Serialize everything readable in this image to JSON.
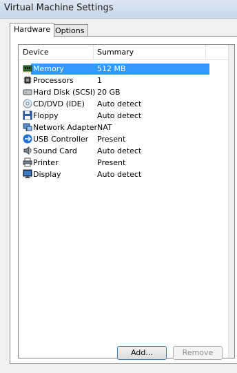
{
  "window": {
    "title": "Virtual Machine Settings"
  },
  "tabs": [
    {
      "label": "Hardware",
      "selected": true
    },
    {
      "label": "Options",
      "selected": false
    }
  ],
  "list": {
    "headers": {
      "device": "Device",
      "summary": "Summary"
    },
    "rows": [
      {
        "device": "Memory",
        "summary": "512 MB",
        "icon": "memory-icon",
        "selected": true
      },
      {
        "device": "Processors",
        "summary": "1",
        "icon": "processor-icon"
      },
      {
        "device": "Hard Disk (SCSI)",
        "summary": "20 GB",
        "icon": "hard-disk-icon"
      },
      {
        "device": "CD/DVD (IDE)",
        "summary": "Auto detect",
        "icon": "cd-dvd-icon"
      },
      {
        "device": "Floppy",
        "summary": "Auto detect",
        "icon": "floppy-icon"
      },
      {
        "device": "Network Adapter",
        "summary": "NAT",
        "icon": "network-adapter-icon"
      },
      {
        "device": "USB Controller",
        "summary": "Present",
        "icon": "usb-icon"
      },
      {
        "device": "Sound Card",
        "summary": "Auto detect",
        "icon": "sound-card-icon"
      },
      {
        "device": "Printer",
        "summary": "Present",
        "icon": "printer-icon"
      },
      {
        "device": "Display",
        "summary": "Auto detect",
        "icon": "display-icon"
      }
    ]
  },
  "buttons": {
    "add": "Add...",
    "remove": "Remove"
  },
  "colors": {
    "selection": "#3399ff",
    "titlebar": "#c9d7ea"
  }
}
